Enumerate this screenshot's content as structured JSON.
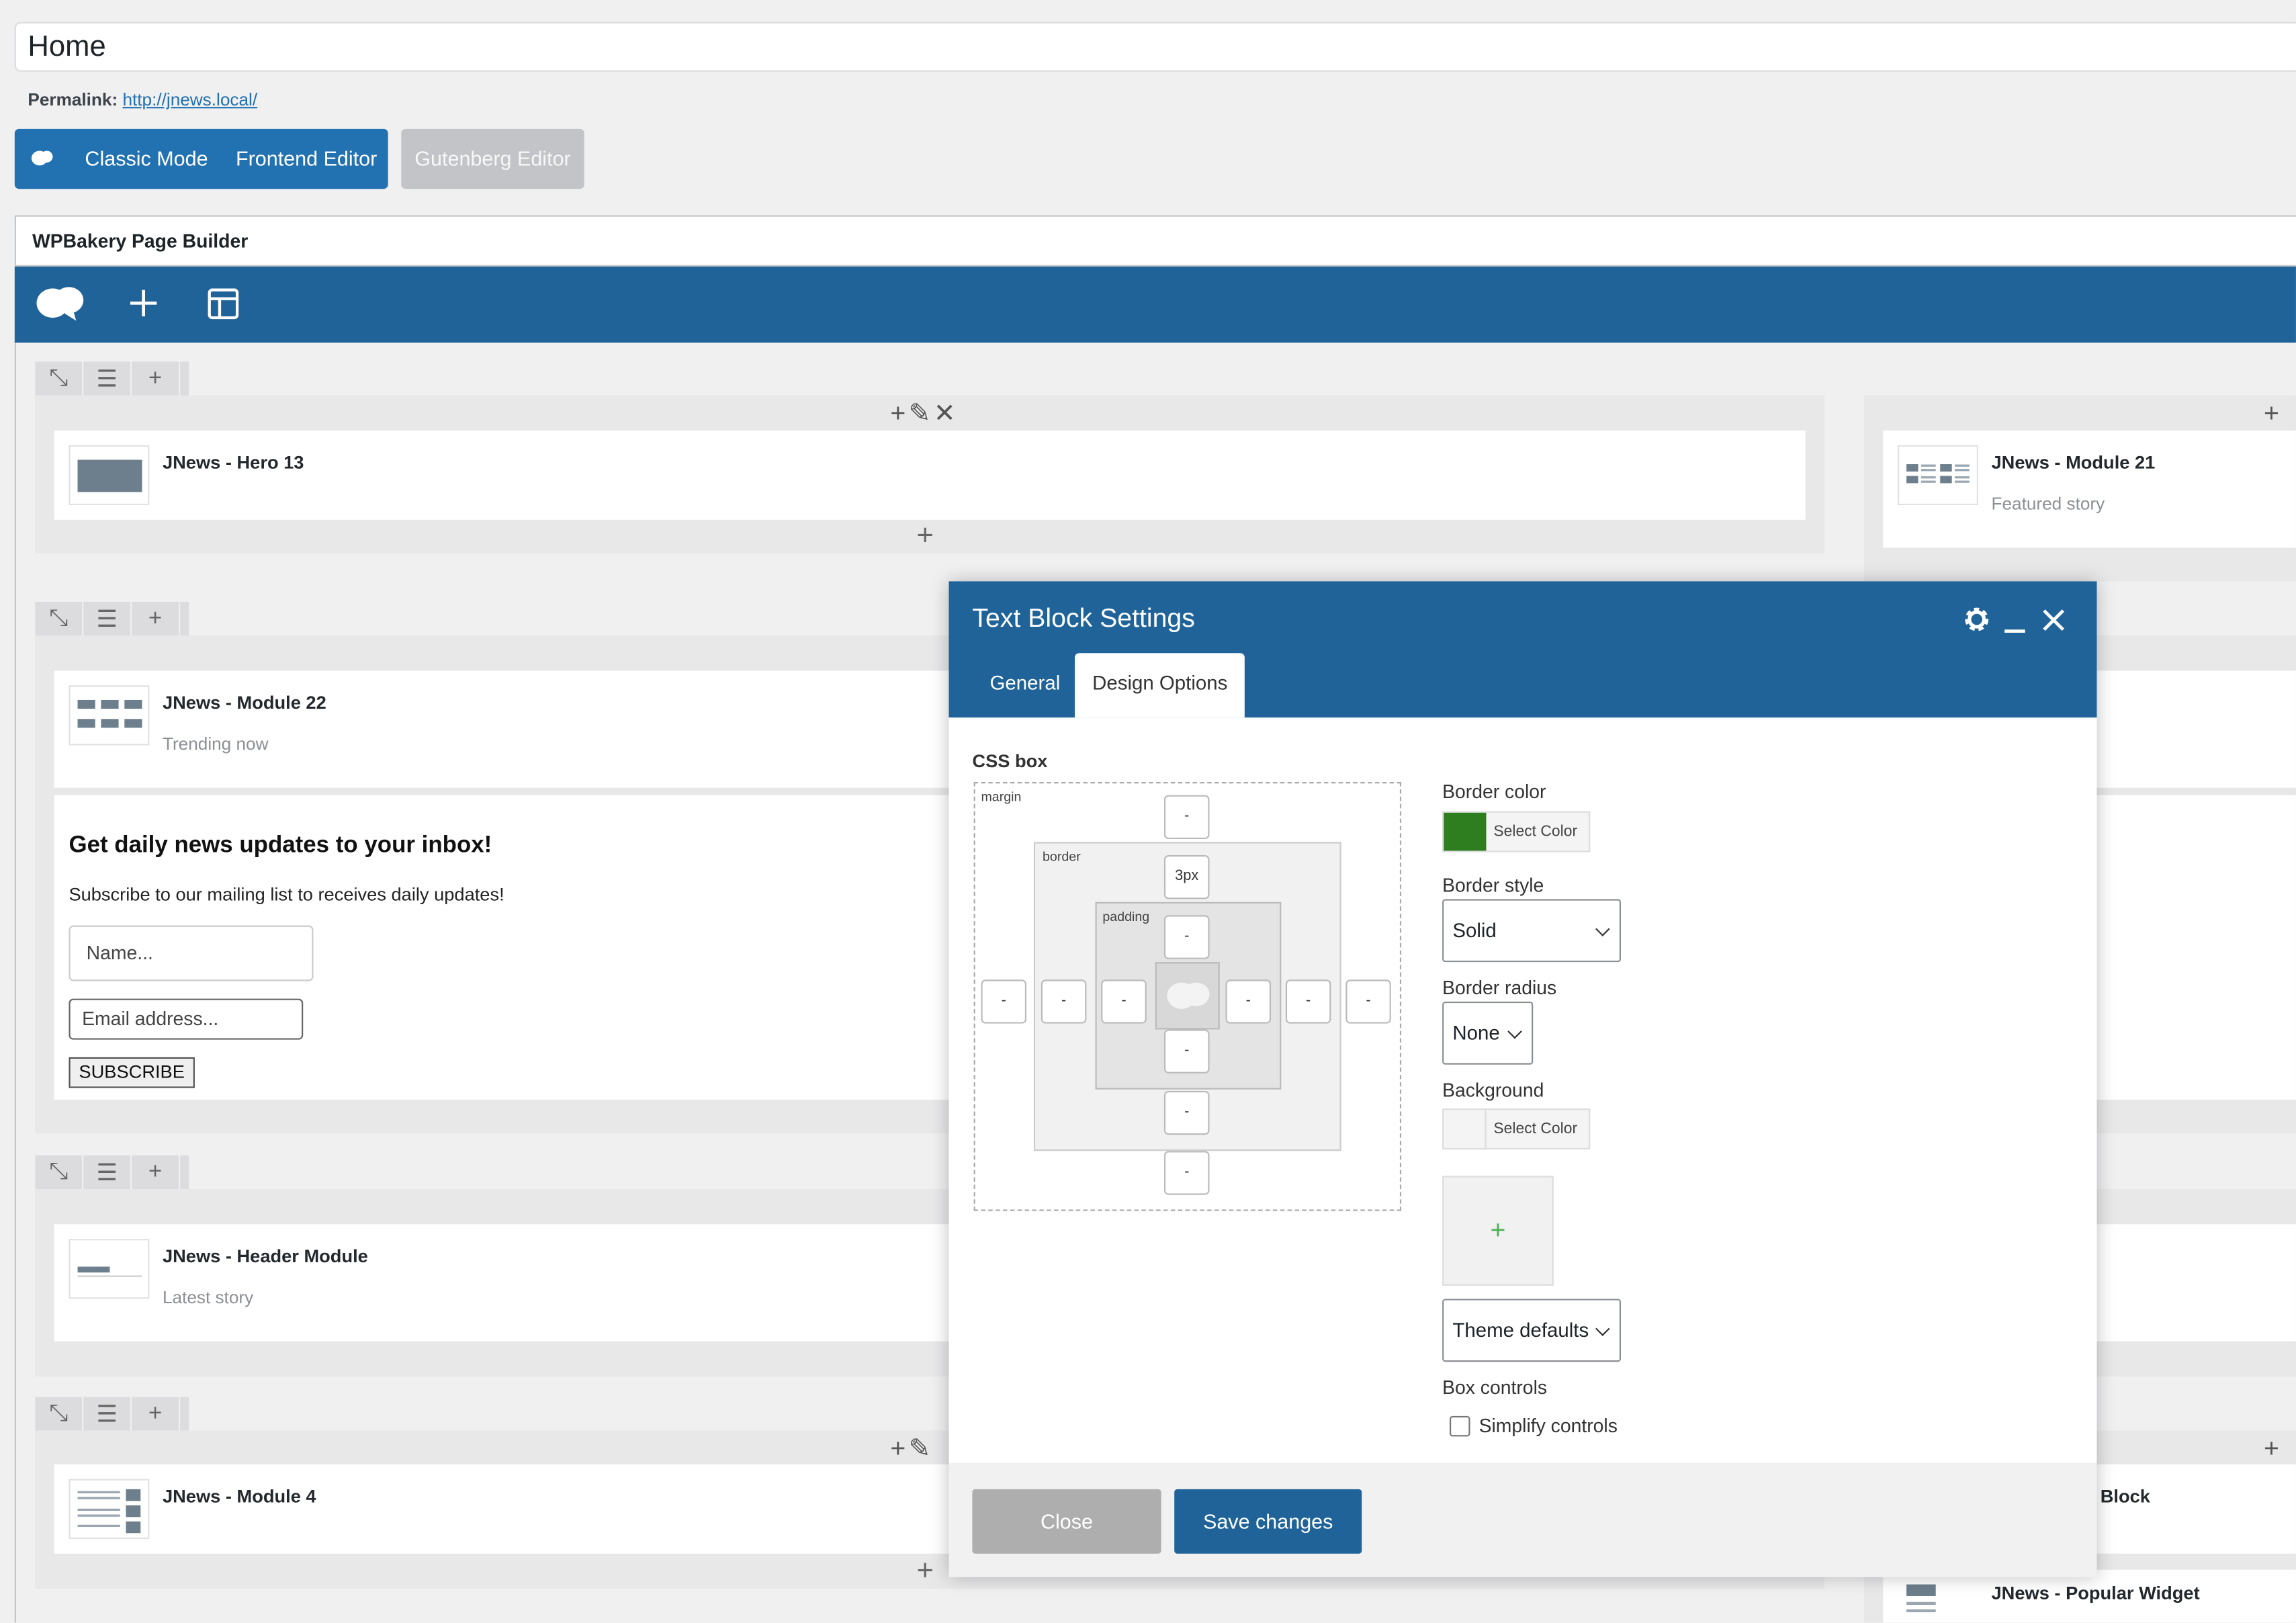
{
  "post": {
    "title": "Home",
    "permalink_label": "Permalink:",
    "permalink_url": "http://jnews.local/"
  },
  "modes": {
    "classic": "Classic Mode",
    "frontend": "Frontend Editor",
    "gutenberg": "Gutenberg Editor"
  },
  "builder": {
    "title": "WPBakery Page Builder"
  },
  "elements": [
    {
      "title": "JNews - Hero 13",
      "subtitle": ""
    },
    {
      "title": "JNews - Module 21",
      "subtitle": "Featured story"
    },
    {
      "title": "JNews - Module 22",
      "subtitle": "Trending now"
    },
    {
      "title": "JNews - Header Module",
      "subtitle": "Latest story"
    },
    {
      "title": "JNews - Module 4",
      "subtitle": ""
    },
    {
      "title": "JNews - Popular Widget",
      "subtitle": ""
    },
    {
      "title": "s Block",
      "subtitle": ""
    }
  ],
  "newsletter": {
    "heading": "Get daily news updates to your inbox!",
    "text": "Subscribe to our mailing list to receives daily updates!",
    "name_placeholder": "Name...",
    "email_placeholder": "Email address...",
    "button": "SUBSCRIBE"
  },
  "modal": {
    "title": "Text Block Settings",
    "tabs": [
      "General",
      "Design Options"
    ],
    "cssbox": {
      "label": "CSS box",
      "margin_label": "margin",
      "border_label": "border",
      "padding_label": "padding",
      "empty": "-",
      "border_top": "3px"
    },
    "border_color_label": "Border color",
    "border_color_value": "#2e7d1f",
    "select_color": "Select Color",
    "border_style_label": "Border style",
    "border_style_value": "Solid",
    "border_radius_label": "Border radius",
    "border_radius_value": "None",
    "background_label": "Background",
    "bg_image_plus": "+",
    "bg_size_value": "Theme defaults",
    "box_controls_label": "Box controls",
    "simplify_label": "Simplify controls",
    "close": "Close",
    "save": "Save changes"
  },
  "colors": {
    "brand": "#1f6399",
    "button_blue": "#2271b1"
  }
}
